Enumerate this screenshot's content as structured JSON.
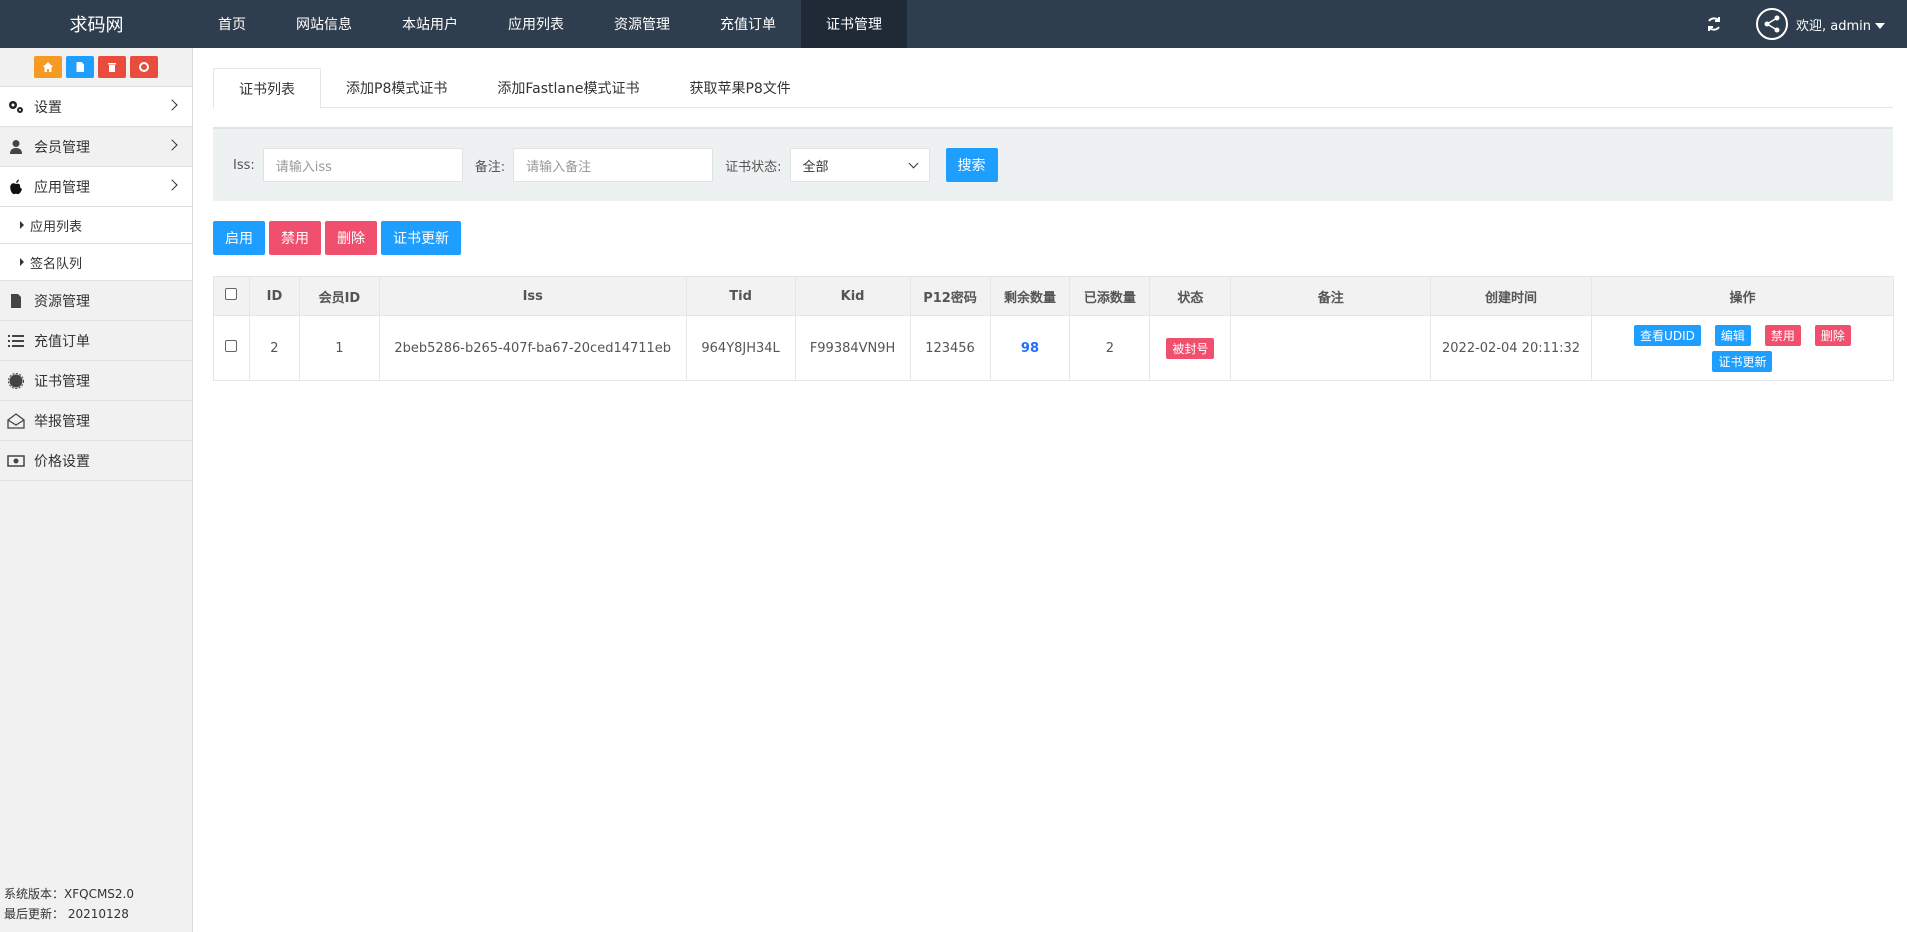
{
  "brand": "求码网",
  "topnav": [
    "首页",
    "网站信息",
    "本站用户",
    "应用列表",
    "资源管理",
    "充值订单",
    "证书管理"
  ],
  "user": {
    "welcome": "欢迎, admin"
  },
  "sidebar": {
    "items": [
      {
        "label": "设置",
        "icon": "gears-icon"
      },
      {
        "label": "会员管理",
        "icon": "user-icon"
      },
      {
        "label": "应用管理",
        "icon": "apple-icon"
      },
      {
        "label": "资源管理",
        "icon": "file-icon"
      },
      {
        "label": "充值订单",
        "icon": "list-icon"
      },
      {
        "label": "证书管理",
        "icon": "certificate-icon"
      },
      {
        "label": "举报管理",
        "icon": "envelope-open-icon"
      },
      {
        "label": "价格设置",
        "icon": "money-icon"
      }
    ],
    "subitems": [
      "应用列表",
      "签名队列"
    ],
    "version_label": "系统版本：XFQCMS2.0",
    "updated_label": "最后更新： 20210128"
  },
  "tabs": [
    "证书列表",
    "添加P8模式证书",
    "添加Fastlane模式证书",
    "获取苹果P8文件"
  ],
  "filter": {
    "iss_label": "Iss:",
    "iss_placeholder": "请输入iss",
    "note_label": "备注:",
    "note_placeholder": "请输入备注",
    "status_label": "证书状态:",
    "status_value": "全部",
    "search_button": "搜索"
  },
  "actions": {
    "enable": "启用",
    "disable": "禁用",
    "delete": "删除",
    "renew": "证书更新"
  },
  "table": {
    "headers": [
      "ID",
      "会员ID",
      "Iss",
      "Tid",
      "Kid",
      "P12密码",
      "剩余数量",
      "已添数量",
      "状态",
      "备注",
      "创建时间",
      "操作"
    ],
    "rows": [
      {
        "id": "2",
        "member_id": "1",
        "iss": "2beb5286-b265-407f-ba67-20ced14711eb",
        "tid": "964Y8JH34L",
        "kid": "F99384VN9H",
        "p12": "123456",
        "remaining": "98",
        "added": "2",
        "status": "被封号",
        "note": "",
        "created": "2022-02-04 20:11:32",
        "ops": {
          "udid": "查看UDID",
          "edit": "编辑",
          "disable": "禁用",
          "delete": "删除",
          "renew": "证书更新"
        }
      }
    ]
  },
  "colors": {
    "topbar": "#2f3e4e",
    "primary": "#1e9fff",
    "danger": "#f0506e",
    "orange": "#f59a23"
  }
}
